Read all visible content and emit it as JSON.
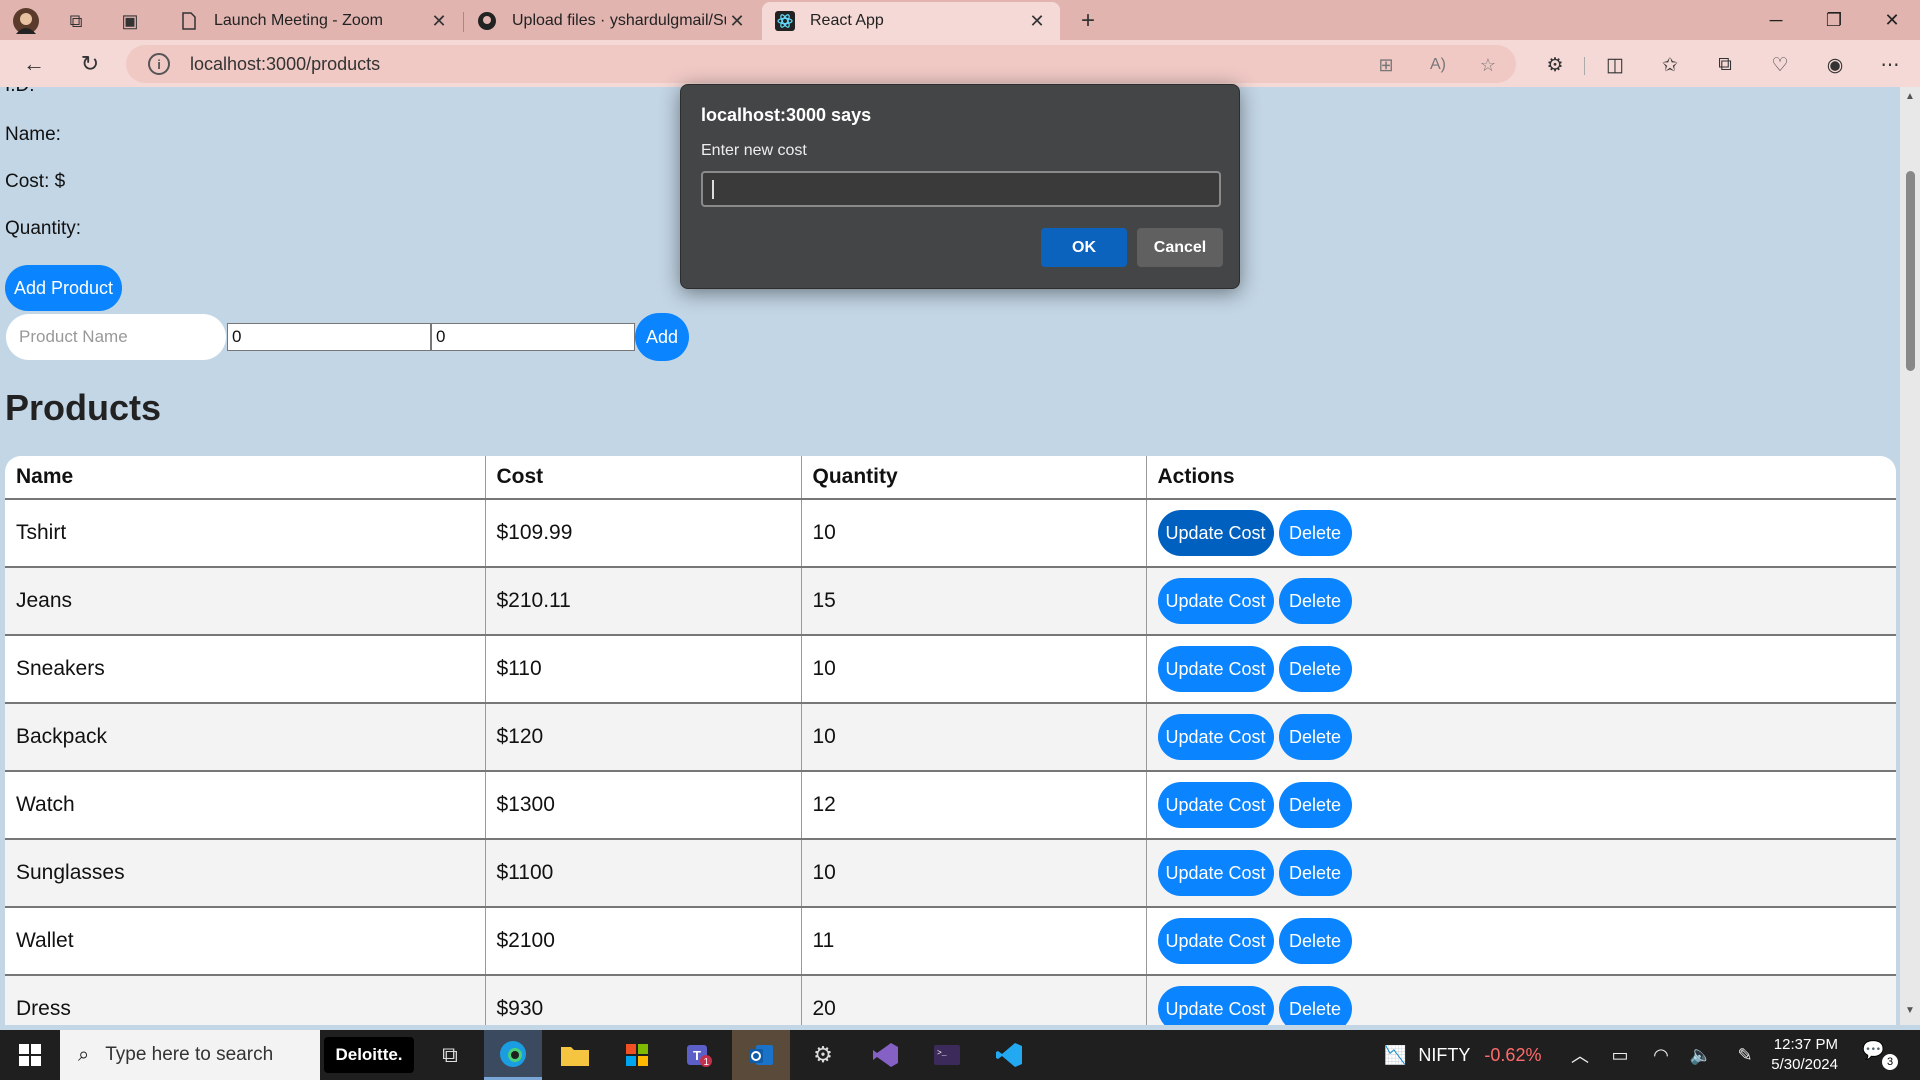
{
  "browser": {
    "tabs": [
      {
        "title": "Launch Meeting - Zoom",
        "icon": "page-icon"
      },
      {
        "title": "Upload files · yshardulgmail/Supr",
        "icon": "github-icon"
      },
      {
        "title": "React App",
        "icon": "react-icon"
      }
    ],
    "url": "localhost:3000/products"
  },
  "page": {
    "id_label": "I.D:",
    "name_label": "Name:",
    "cost_label": "Cost: $",
    "quantity_label": "Quantity:",
    "add_product_label": "Add Product",
    "product_name_placeholder": "Product Name",
    "cost_input_value": "0",
    "quantity_input_value": "0",
    "add_label": "Add",
    "heading": "Products",
    "table": {
      "headers": [
        "Name",
        "Cost",
        "Quantity",
        "Actions"
      ],
      "update_label": "Update Cost",
      "delete_label": "Delete",
      "rows": [
        {
          "name": "Tshirt",
          "cost": "$109.99",
          "quantity": "10"
        },
        {
          "name": "Jeans",
          "cost": "$210.11",
          "quantity": "15"
        },
        {
          "name": "Sneakers",
          "cost": "$110",
          "quantity": "10"
        },
        {
          "name": "Backpack",
          "cost": "$120",
          "quantity": "10"
        },
        {
          "name": "Watch",
          "cost": "$1300",
          "quantity": "12"
        },
        {
          "name": "Sunglasses",
          "cost": "$1100",
          "quantity": "10"
        },
        {
          "name": "Wallet",
          "cost": "$2100",
          "quantity": "11"
        },
        {
          "name": "Dress",
          "cost": "$930",
          "quantity": "20"
        }
      ]
    }
  },
  "dialog": {
    "title": "localhost:3000 says",
    "message": "Enter new cost",
    "input_value": "",
    "ok_label": "OK",
    "cancel_label": "Cancel"
  },
  "taskbar": {
    "search_placeholder": "Type here to search",
    "deloitte_label": "Deloitte.",
    "nifty_label": "NIFTY",
    "nifty_change": "-0.62%",
    "time": "12:37 PM",
    "date": "5/30/2024",
    "notification_count": "3",
    "teams_badge": "1"
  },
  "colors": {
    "page_bg": "#c3d6e6",
    "primary_button": "#0a84ff",
    "tab_strip": "#e1b4b0",
    "dialog_bg": "#444546",
    "dialog_ok": "#0b63bd"
  }
}
